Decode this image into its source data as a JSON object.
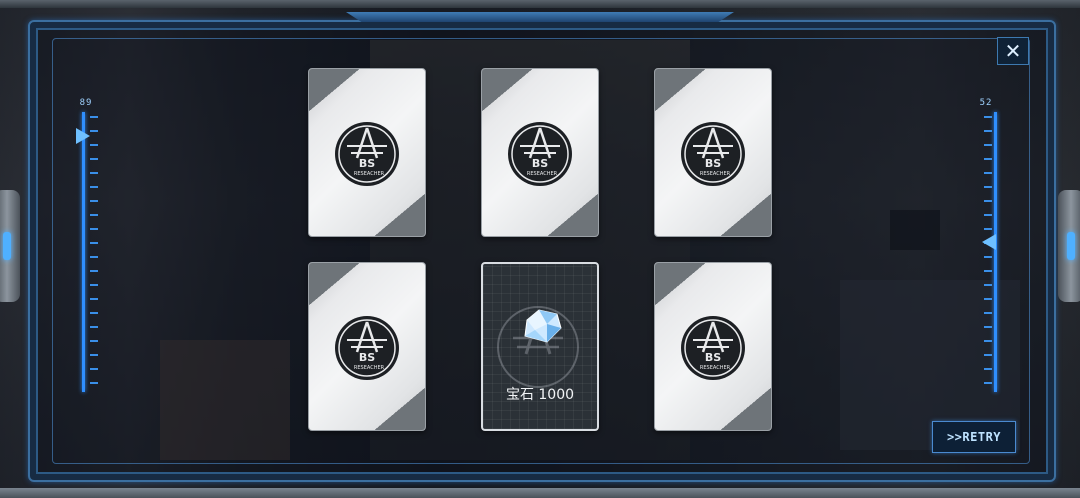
{
  "card_emblem_text": {
    "top": "BS",
    "ring": "RESEACHER"
  },
  "cards": [
    {
      "state": "face-down"
    },
    {
      "state": "face-down"
    },
    {
      "state": "face-down"
    },
    {
      "state": "face-down"
    },
    {
      "state": "revealed",
      "reward_label": "宝石 1000",
      "reward_icon": "gem-icon"
    },
    {
      "state": "face-down"
    }
  ],
  "gauges": {
    "left": {
      "label": "89"
    },
    "right": {
      "label": "52"
    }
  },
  "retry_label": ">>RETRY",
  "close_label": "✕",
  "colors": {
    "accent": "#2f8fff",
    "frame": "#3b6fa0",
    "card_face": "#f4f5f6",
    "card_revealed": "#2b3137"
  }
}
